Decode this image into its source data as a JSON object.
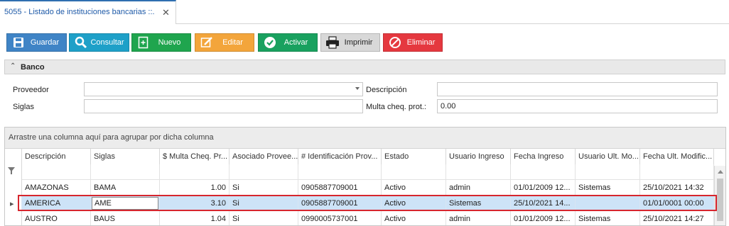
{
  "tab": {
    "title": "5055 - Listado de instituciones bancarias ::.",
    "close": "✕"
  },
  "toolbar": {
    "buttons": [
      {
        "label": "Guardar",
        "icon": "floppy-disk-icon",
        "color": "#3f84c6"
      },
      {
        "label": "Consultar",
        "icon": "search-icon",
        "color": "#1ea0c8"
      },
      {
        "label": "Nuevo",
        "icon": "new-document-icon",
        "color": "#1fa54e"
      },
      {
        "label": "Editar",
        "icon": "edit-icon",
        "color": "#f3a53b"
      },
      {
        "label": "Activar",
        "icon": "check-circle-icon",
        "color": "#19a15f"
      },
      {
        "label": "Imprimir",
        "icon": "printer-icon",
        "color": "#d8d8d8"
      },
      {
        "label": "Eliminar",
        "icon": "forbidden-icon",
        "color": "#e5383f"
      }
    ]
  },
  "panel": {
    "title": "Banco",
    "proveedor_label": "Proveedor",
    "proveedor_value": "",
    "siglas_label": "Siglas",
    "siglas_value": "",
    "descripcion_label": "Descripción",
    "descripcion_value": "",
    "multa_label": "Multa cheq. prot.:",
    "multa_value": "0.00"
  },
  "grid": {
    "group_hint": "Arrastre una columna aquí para agrupar por dicha columna",
    "columns": [
      "Descripción",
      "Siglas",
      "$ Multa Cheq. Pr...",
      "Asociado Provee...",
      "# Identificación Prov...",
      "Estado",
      "Usuario Ingreso",
      "Fecha Ingreso",
      "Usuario Ult. Mo...",
      "Fecha Ult. Modific..."
    ],
    "rows": [
      [
        "AMAZONAS",
        "BAMA",
        "1.00",
        "Si",
        "0905887709001",
        "Activo",
        "admin",
        "01/01/2009 12...",
        "Sistemas",
        "25/10/2021 14:32"
      ],
      [
        "AMERICA",
        "AME",
        "3.10",
        "Si",
        "0905887709001",
        "Activo",
        "Sistemas",
        "25/10/2021 14...",
        "",
        "01/01/0001 00:00"
      ],
      [
        "AUSTRO",
        "BAUS",
        "1.04",
        "Si",
        "0990005737001",
        "Activo",
        "admin",
        "01/01/2009 12...",
        "Sistemas",
        "25/10/2021 14:27"
      ]
    ],
    "selected_index": 1,
    "highlight_color": "#d7262e"
  }
}
